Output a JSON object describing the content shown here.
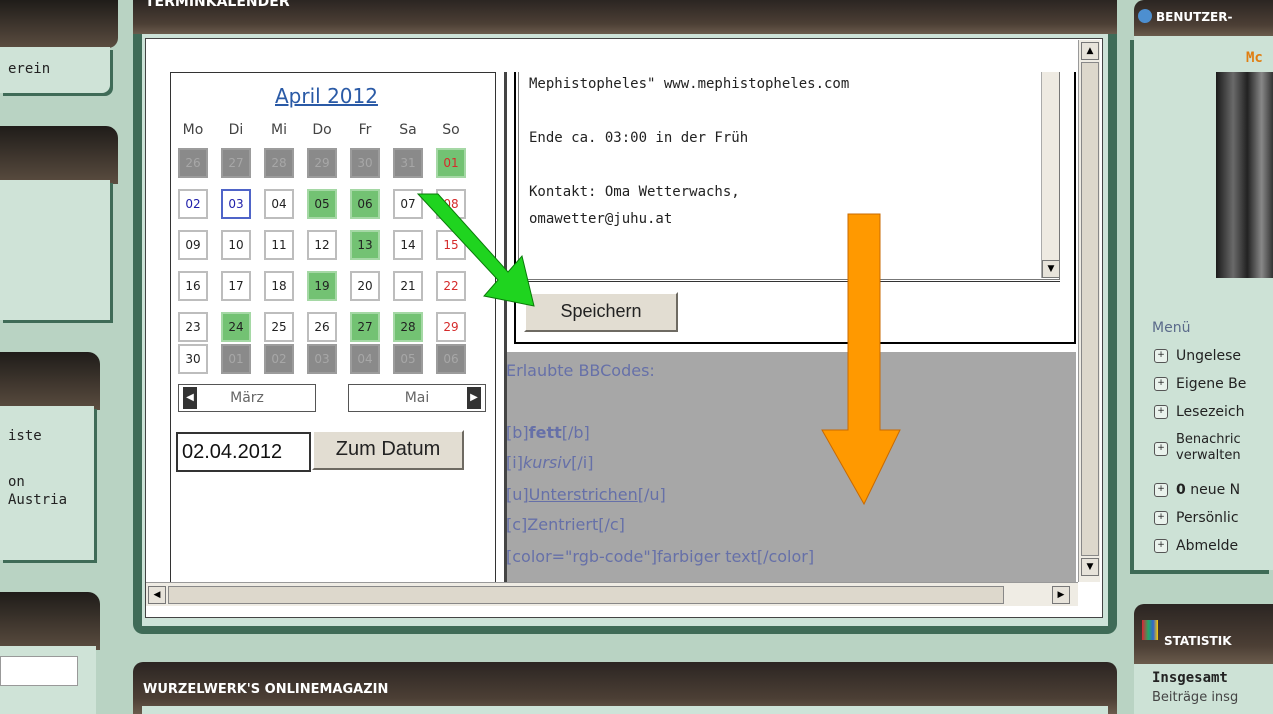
{
  "left": {
    "item1": "erein",
    "item2": "iste",
    "item3_line1": "on",
    "item3_line2": "Austria"
  },
  "calendar_panel": {
    "title": "TERMINKALENDER",
    "month_title": "April 2012",
    "weekdays": [
      "Mo",
      "Di",
      "Mi",
      "Do",
      "Fr",
      "Sa",
      "So"
    ],
    "weeks": [
      [
        [
          "26",
          "grey"
        ],
        [
          "27",
          "grey"
        ],
        [
          "28",
          "grey"
        ],
        [
          "29",
          "grey"
        ],
        [
          "30",
          "grey"
        ],
        [
          "31",
          "grey"
        ],
        [
          "01",
          "green red"
        ]
      ],
      [
        [
          "02",
          "blue"
        ],
        [
          "03",
          "blue today"
        ],
        [
          "04",
          ""
        ],
        [
          "05",
          "green"
        ],
        [
          "06",
          "green"
        ],
        [
          "07",
          ""
        ],
        [
          "08",
          "red"
        ]
      ],
      [
        [
          "09",
          ""
        ],
        [
          "10",
          ""
        ],
        [
          "11",
          ""
        ],
        [
          "12",
          ""
        ],
        [
          "13",
          "green"
        ],
        [
          "14",
          ""
        ],
        [
          "15",
          "red"
        ]
      ],
      [
        [
          "16",
          ""
        ],
        [
          "17",
          ""
        ],
        [
          "18",
          ""
        ],
        [
          "19",
          "green"
        ],
        [
          "20",
          ""
        ],
        [
          "21",
          ""
        ],
        [
          "22",
          "red"
        ]
      ],
      [
        [
          "23",
          ""
        ],
        [
          "24",
          "green"
        ],
        [
          "25",
          ""
        ],
        [
          "26",
          ""
        ],
        [
          "27",
          "green"
        ],
        [
          "28",
          "green"
        ],
        [
          "29",
          "red"
        ]
      ],
      [
        [
          "30",
          ""
        ],
        [
          "01",
          "grey"
        ],
        [
          "02",
          "grey"
        ],
        [
          "03",
          "grey"
        ],
        [
          "04",
          "grey"
        ],
        [
          "05",
          "grey"
        ],
        [
          "06",
          "grey"
        ]
      ]
    ],
    "prev_month": "März",
    "next_month": "Mai",
    "date_input_value": "02.04.2012",
    "goto_button": "Zum Datum",
    "editor_lines": [
      "Mephistopheles\" www.mephistopheles.com",
      "",
      "Ende ca. 03:00 in der Früh",
      "",
      "Kontakt: Oma Wetterwachs,",
      "omawetter@juhu.at"
    ],
    "save_button": "Speichern",
    "bbcodes_title": "Erlaubte BBCodes:",
    "bb_bold_open": "[b]",
    "bb_bold_text": "fett",
    "bb_bold_close": "[/b]",
    "bb_italic_open": "[i]",
    "bb_italic_text": "kursiv",
    "bb_italic_close": "[/i]",
    "bb_under_open": "[u]",
    "bb_under_text": "Unterstrichen",
    "bb_under_close": "[/u]",
    "bb_center": "[c]Zentriert[/c]",
    "bb_color": "[color=\"rgb-code\"]farbiger text[/color]"
  },
  "magazine_panel": {
    "title": "WURZELWERK'S ONLINEMAGAZIN"
  },
  "right": {
    "user_title": "BENUTZER-",
    "user_name": "Mc",
    "menu_label": "Menü",
    "menu_items": [
      "Ungelese",
      "Eigene Be",
      "Lesezeich",
      "Benachric",
      "verwalten",
      "neue N",
      "Persönlic",
      "Abmelde"
    ],
    "new_count": "0",
    "stats_title": "STATISTIK",
    "stats_total": "Insgesamt",
    "stats_posts": "Beiträge insg"
  },
  "colors": {
    "green_arrow": "#1fd41f",
    "orange_arrow": "#ff9900"
  }
}
